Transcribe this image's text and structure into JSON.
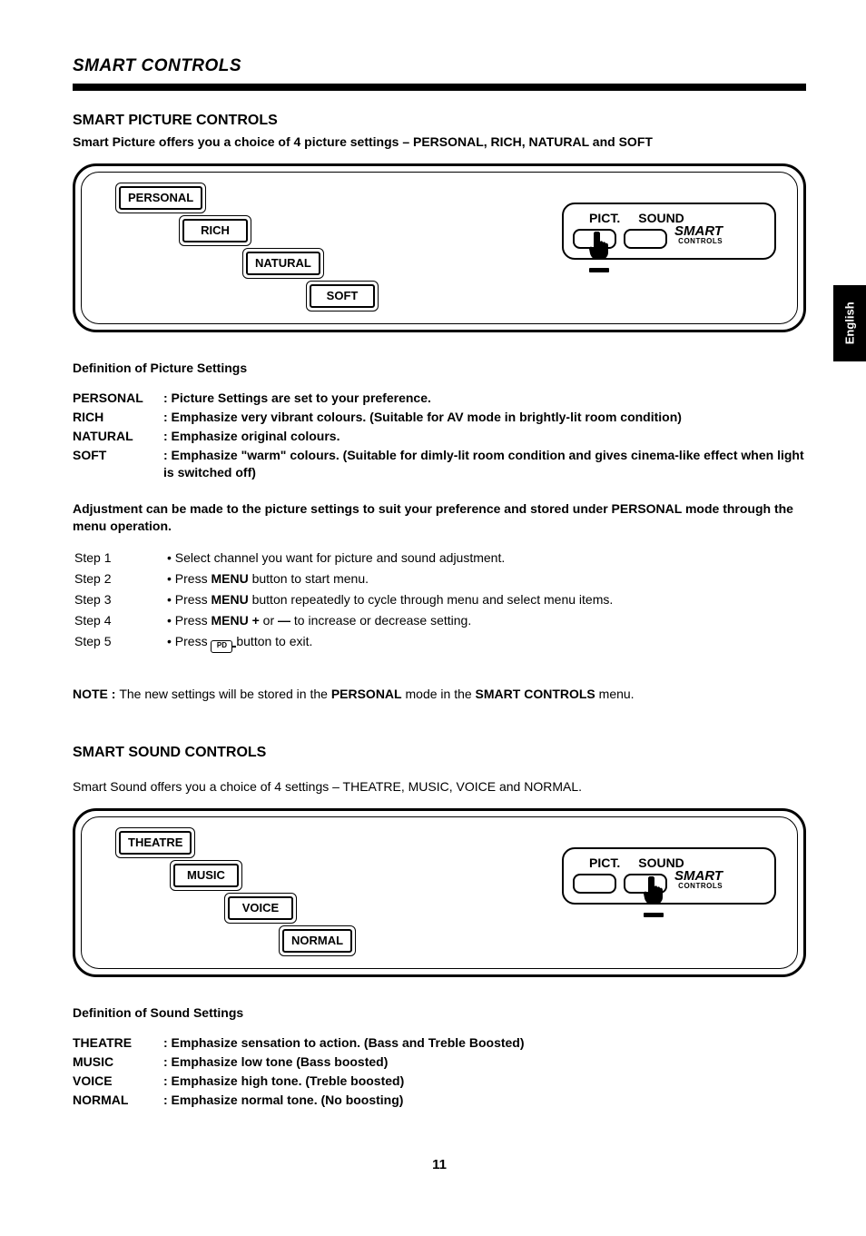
{
  "page": {
    "title": "SMART CONTROLS",
    "number": "11",
    "language_tab": "English"
  },
  "picture": {
    "title": "SMART PICTURE CONTROLS",
    "intro": "Smart Picture offers you a choice of 4 picture settings – PERSONAL, RICH, NATURAL and SOFT",
    "options": [
      "PERSONAL",
      "RICH",
      "NATURAL",
      "SOFT"
    ],
    "panel": {
      "pict": "PICT.",
      "sound": "SOUND",
      "brand_big": "SMART",
      "brand_small": "CONTROLS"
    },
    "def_heading": "Definition of Picture Settings",
    "defs": [
      {
        "term": "PERSONAL",
        "desc": ": Picture Settings are set to your preference."
      },
      {
        "term": "RICH",
        "desc": ": Emphasize very vibrant colours. (Suitable for AV mode in brightly-lit room condition)"
      },
      {
        "term": "NATURAL",
        "desc": ": Emphasize original colours."
      },
      {
        "term": "SOFT",
        "desc": ": Emphasize \"warm\" colours. (Suitable for dimly-lit room condition and gives cinema-like effect when light is switched off)"
      }
    ],
    "adjust_para": "Adjustment can be made to the picture settings to suit your preference and stored under PERSONAL mode through the menu operation.",
    "steps": [
      {
        "label": "Step 1",
        "bullet": "• Select channel you want for picture and sound adjustment."
      },
      {
        "label": "Step 2",
        "bullet_prefix": "• Press ",
        "bold": "MENU",
        "bullet_suffix": " button to start menu."
      },
      {
        "label": "Step 3",
        "bullet_prefix": "• Press ",
        "bold": "MENU",
        "bullet_suffix": " button repeatedly to cycle through menu and select menu items."
      },
      {
        "label": "Step 4",
        "bullet_prefix": "• Press ",
        "bold": "MENU +",
        "mid": " or ",
        "bold2": "—",
        "bullet_suffix": " to increase or decrease setting."
      },
      {
        "label": "Step 5",
        "bullet_prefix": "• Press ",
        "icon": true,
        "bullet_suffix": " button to exit."
      }
    ],
    "note_prefix": "NOTE : ",
    "note_text1": "The new settings will be stored in the ",
    "note_bold1": "PERSONAL",
    "note_text2": " mode in the ",
    "note_bold2": "SMART CONTROLS",
    "note_text3": " menu."
  },
  "sound": {
    "title": "SMART SOUND CONTROLS",
    "intro": "Smart Sound offers you a choice of 4 settings – THEATRE, MUSIC, VOICE and NORMAL.",
    "options": [
      "THEATRE",
      "MUSIC",
      "VOICE",
      "NORMAL"
    ],
    "panel": {
      "pict": "PICT.",
      "sound": "SOUND",
      "brand_big": "SMART",
      "brand_small": "CONTROLS"
    },
    "def_heading": "Definition of Sound Settings",
    "defs": [
      {
        "term": "THEATRE",
        "desc": ": Emphasize sensation to action. (Bass and Treble Boosted)"
      },
      {
        "term": "MUSIC",
        "desc": ": Emphasize low tone (Bass boosted)"
      },
      {
        "term": "VOICE",
        "desc": ": Emphasize high tone. (Treble boosted)"
      },
      {
        "term": "NORMAL",
        "desc": ": Emphasize normal tone. (No boosting)"
      }
    ]
  }
}
